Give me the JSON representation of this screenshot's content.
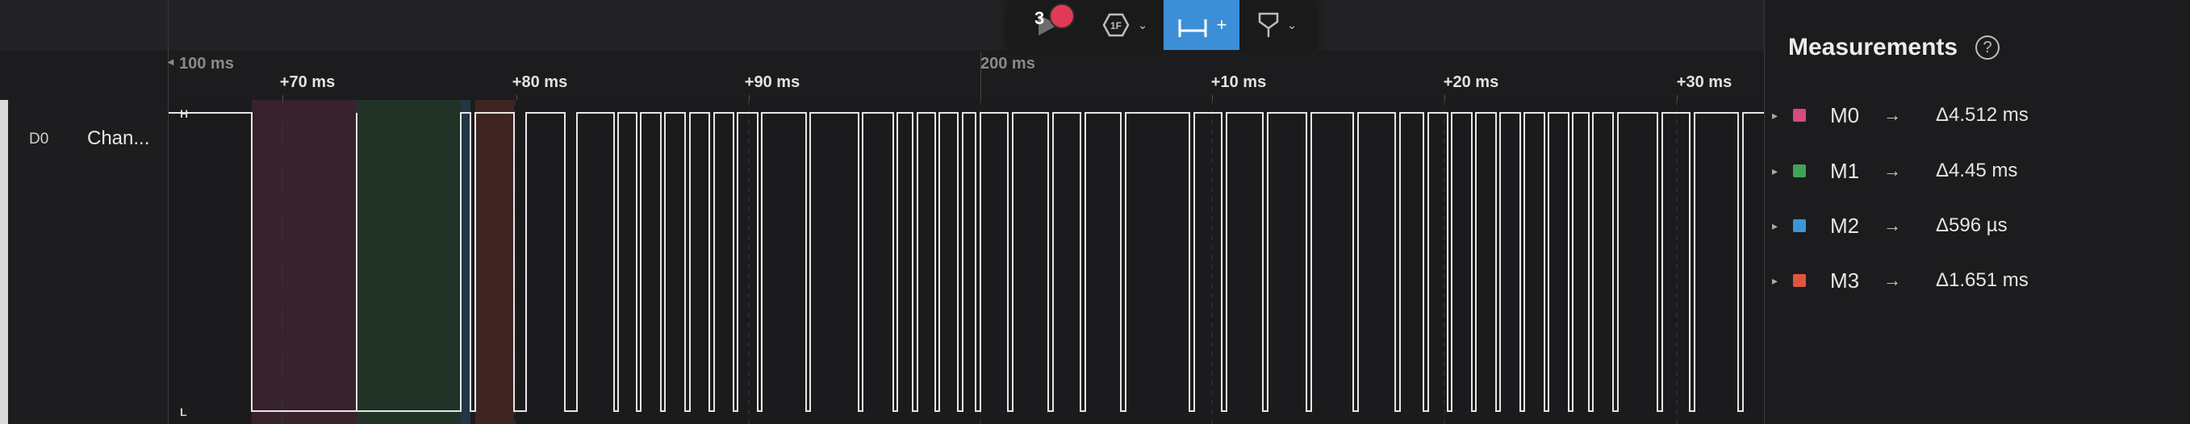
{
  "toolbar": {
    "run_icon": "play-icon",
    "record_icon": "record-dot-icon",
    "trigger_icon": "trigger-hexagon-icon",
    "trigger_glyph": "1F",
    "measure_count": "3",
    "measure_add": "+",
    "marker_icon": "marker-flag-icon",
    "chevron": "⌄"
  },
  "ruler": {
    "major_left_label": "100 ms",
    "major_mid_label": "200 ms",
    "ticks": [
      "+70 ms",
      "+80 ms",
      "+90 ms",
      "+10 ms",
      "+20 ms",
      "+30 ms"
    ]
  },
  "channel": {
    "id": "D0",
    "name": "Chan...",
    "high_label": "H",
    "low_label": "L"
  },
  "measurements": {
    "title": "Measurements",
    "help_glyph": "?",
    "arrow_glyph": "→",
    "expand_glyph": "▸",
    "items": [
      {
        "name": "M0",
        "value": "Δ4.512 ms",
        "color": "#d64b7c"
      },
      {
        "name": "M1",
        "value": "Δ4.45 ms",
        "color": "#3fa257"
      },
      {
        "name": "M2",
        "value": "Δ596 µs",
        "color": "#3d95d6"
      },
      {
        "name": "M3",
        "value": "Δ1.651 ms",
        "color": "#e0553f"
      }
    ]
  },
  "colors": {
    "accent": "#3c8fd6",
    "record": "#e03a56",
    "trace": "#e6e6e6"
  }
}
